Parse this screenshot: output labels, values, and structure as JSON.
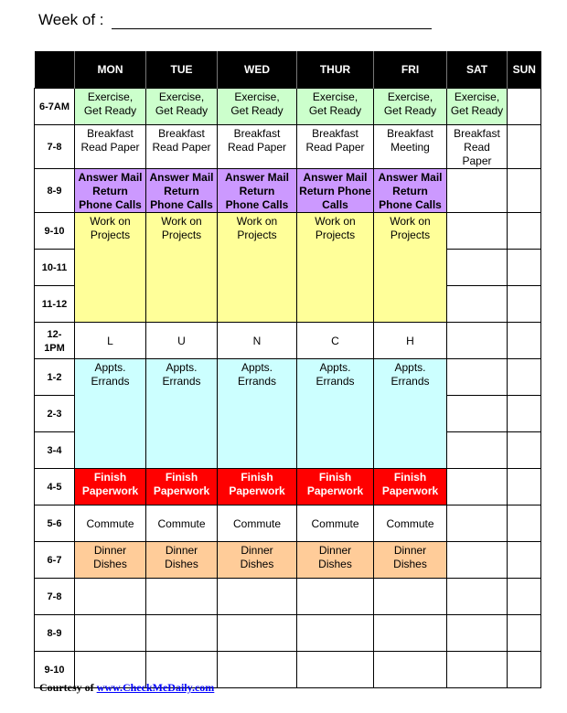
{
  "header": {
    "week_label": "Week of :"
  },
  "colors": {
    "exercise": "#ccffcc",
    "mail": "#cc99ff",
    "projects": "#ffff99",
    "appts": "#ccffff",
    "finish": "#ff0000",
    "dinner": "#ffcc99"
  },
  "columns": [
    "",
    "MON",
    "TUE",
    "WED",
    "THUR",
    "FRI",
    "SAT",
    "SUN"
  ],
  "rows": [
    {
      "time": "6-7AM",
      "cells": [
        {
          "text": "Exercise,\nGet Ready",
          "color": "exercise"
        },
        {
          "text": "Exercise,\nGet Ready",
          "color": "exercise"
        },
        {
          "text": "Exercise,\nGet Ready",
          "color": "exercise"
        },
        {
          "text": "Exercise,\nGet Ready",
          "color": "exercise"
        },
        {
          "text": "Exercise,\nGet Ready",
          "color": "exercise"
        },
        {
          "text": "Exercise,\nGet Ready",
          "color": "exercise"
        },
        {
          "text": ""
        }
      ]
    },
    {
      "time": "7-8",
      "cells": [
        {
          "text": "Breakfast\nRead Paper"
        },
        {
          "text": "Breakfast\nRead Paper"
        },
        {
          "text": "Breakfast\nRead Paper"
        },
        {
          "text": "Breakfast\nRead Paper"
        },
        {
          "text": "Breakfast\nMeeting"
        },
        {
          "text": "Breakfast\nRead\nPaper"
        },
        {
          "text": ""
        }
      ]
    },
    {
      "time": "8-9",
      "cells": [
        {
          "text": "Answer Mail\nReturn\nPhone Calls",
          "color": "mail",
          "bold": true
        },
        {
          "text": "Answer Mail\nReturn\nPhone Calls",
          "color": "mail",
          "bold": true
        },
        {
          "text": "Answer Mail\nReturn\nPhone Calls",
          "color": "mail",
          "bold": true
        },
        {
          "text": "Answer Mail\nReturn Phone\nCalls",
          "color": "mail",
          "bold": true
        },
        {
          "text": "Answer Mail\nReturn\nPhone Calls",
          "color": "mail",
          "bold": true
        },
        {
          "text": ""
        },
        {
          "text": ""
        }
      ]
    },
    {
      "time": "9-10",
      "cells": [
        {
          "text": "Work on\nProjects",
          "color": "projects",
          "rowspan": 3
        },
        {
          "text": "Work on\nProjects",
          "color": "projects",
          "rowspan": 3
        },
        {
          "text": "Work on\nProjects",
          "color": "projects",
          "rowspan": 3
        },
        {
          "text": "Work on\nProjects",
          "color": "projects",
          "rowspan": 3
        },
        {
          "text": "Work on\nProjects",
          "color": "projects",
          "rowspan": 3
        },
        {
          "text": ""
        },
        {
          "text": ""
        }
      ]
    },
    {
      "time": "10-11",
      "cells": [
        {
          "text": ""
        },
        {
          "text": ""
        }
      ]
    },
    {
      "time": "11-12",
      "cells": [
        {
          "text": ""
        },
        {
          "text": ""
        }
      ]
    },
    {
      "time": "12-\n1PM",
      "cells": [
        {
          "text": "L",
          "mid": true
        },
        {
          "text": "U",
          "mid": true
        },
        {
          "text": "N",
          "mid": true
        },
        {
          "text": "C",
          "mid": true
        },
        {
          "text": "H",
          "mid": true
        },
        {
          "text": ""
        },
        {
          "text": ""
        }
      ]
    },
    {
      "time": "1-2",
      "cells": [
        {
          "text": "Appts.\nErrands",
          "color": "appts",
          "rowspan": 3
        },
        {
          "text": "Appts.\nErrands",
          "color": "appts",
          "rowspan": 3
        },
        {
          "text": "Appts.\nErrands",
          "color": "appts",
          "rowspan": 3
        },
        {
          "text": "Appts.\nErrands",
          "color": "appts",
          "rowspan": 3
        },
        {
          "text": "Appts.\nErrands",
          "color": "appts",
          "rowspan": 3
        },
        {
          "text": ""
        },
        {
          "text": ""
        }
      ]
    },
    {
      "time": "2-3",
      "cells": [
        {
          "text": ""
        },
        {
          "text": ""
        }
      ]
    },
    {
      "time": "3-4",
      "cells": [
        {
          "text": ""
        },
        {
          "text": ""
        }
      ]
    },
    {
      "time": "4-5",
      "cells": [
        {
          "text": "Finish\nPaperwork",
          "color": "finish",
          "bold": true,
          "fg": "#fff"
        },
        {
          "text": "Finish\nPaperwork",
          "color": "finish",
          "bold": true,
          "fg": "#fff"
        },
        {
          "text": "Finish\nPaperwork",
          "color": "finish",
          "bold": true,
          "fg": "#fff"
        },
        {
          "text": "Finish\nPaperwork",
          "color": "finish",
          "bold": true,
          "fg": "#fff"
        },
        {
          "text": "Finish\nPaperwork",
          "color": "finish",
          "bold": true,
          "fg": "#fff"
        },
        {
          "text": ""
        },
        {
          "text": ""
        }
      ]
    },
    {
      "time": "5-6",
      "cells": [
        {
          "text": "Commute",
          "mid": true
        },
        {
          "text": "Commute",
          "mid": true
        },
        {
          "text": "Commute",
          "mid": true
        },
        {
          "text": "Commute",
          "mid": true
        },
        {
          "text": "Commute",
          "mid": true
        },
        {
          "text": ""
        },
        {
          "text": ""
        }
      ]
    },
    {
      "time": "6-7",
      "cells": [
        {
          "text": "Dinner\nDishes",
          "color": "dinner"
        },
        {
          "text": "Dinner\nDishes",
          "color": "dinner"
        },
        {
          "text": "Dinner\nDishes",
          "color": "dinner"
        },
        {
          "text": "Dinner\nDishes",
          "color": "dinner"
        },
        {
          "text": "Dinner\nDishes",
          "color": "dinner"
        },
        {
          "text": ""
        },
        {
          "text": ""
        }
      ]
    },
    {
      "time": "7-8",
      "cells": [
        {
          "text": ""
        },
        {
          "text": ""
        },
        {
          "text": ""
        },
        {
          "text": ""
        },
        {
          "text": ""
        },
        {
          "text": ""
        },
        {
          "text": ""
        }
      ]
    },
    {
      "time": "8-9",
      "cells": [
        {
          "text": ""
        },
        {
          "text": ""
        },
        {
          "text": ""
        },
        {
          "text": ""
        },
        {
          "text": ""
        },
        {
          "text": ""
        },
        {
          "text": ""
        }
      ]
    },
    {
      "time": "9-10",
      "cells": [
        {
          "text": ""
        },
        {
          "text": ""
        },
        {
          "text": ""
        },
        {
          "text": ""
        },
        {
          "text": ""
        },
        {
          "text": ""
        },
        {
          "text": ""
        }
      ]
    }
  ],
  "footer": {
    "prefix": "Courtesy of ",
    "link": "www.CheckMeDaily.com"
  }
}
